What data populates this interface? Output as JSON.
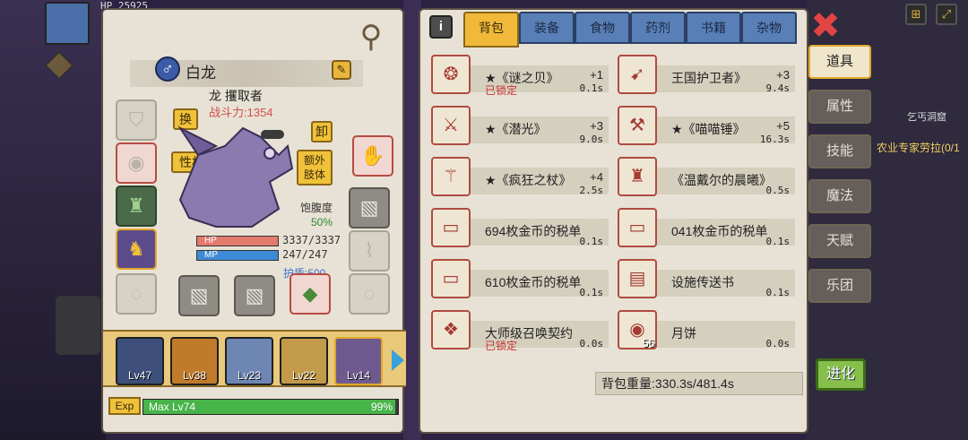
{
  "hud": {
    "hp_text": "HP 25925"
  },
  "character": {
    "gender_symbol": "♂",
    "name": "白龙",
    "race_title": "龙 攫取者",
    "power": "战斗力:1354",
    "swap_button": "换",
    "trait_button": "性格",
    "unequip_button": "卸",
    "extra_limb_button": "额外\n肢体",
    "satiety_label": "饱腹度",
    "satiety_value": "50%",
    "hp_label": "HP",
    "hp_value": "3337/3337",
    "mp_label": "MP",
    "mp_value": "247/247",
    "shield": "护盾:500"
  },
  "party": [
    {
      "level": "Lv47",
      "color": "#3d4f7a"
    },
    {
      "level": "Lv38",
      "color": "#c07a2a"
    },
    {
      "level": "Lv23",
      "color": "#6d86b4"
    },
    {
      "level": "Lv22",
      "color": "#c29a4a"
    },
    {
      "level": "Lv14",
      "color": "#6e5a8e",
      "selected": true
    }
  ],
  "exp": {
    "tag": "Exp",
    "text": "Max Lv74",
    "percent_text": "99%",
    "percent": 99
  },
  "inventory": {
    "tabs": [
      "背包",
      "装备",
      "食物",
      "药剂",
      "书籍",
      "杂物"
    ],
    "active_tab": 0,
    "items": [
      {
        "name": "★《谜之贝》",
        "qty": "+1",
        "weight": "0.1s",
        "locked": "已锁定",
        "icon": "shell-icon",
        "glyph": "❂"
      },
      {
        "name": "王国护卫者》",
        "qty": "+3",
        "weight": "9.4s",
        "icon": "crossbow-icon",
        "glyph": "➹"
      },
      {
        "name": "★《潜光》",
        "qty": "+3",
        "weight": "9.0s",
        "icon": "scythe-icon",
        "glyph": "⚔"
      },
      {
        "name": "★《喵喵锤》",
        "qty": "+5",
        "weight": "16.3s",
        "icon": "hammer-icon",
        "glyph": "⚒"
      },
      {
        "name": "★《疯狂之杖》",
        "qty": "+4",
        "weight": "2.5s",
        "icon": "staff-icon",
        "glyph": "⚚"
      },
      {
        "name": "《温戴尔的晨曦》",
        "qty": "",
        "weight": "0.5s",
        "icon": "armor-icon",
        "glyph": "♜"
      },
      {
        "name": "694枚金币的税单",
        "qty": "",
        "weight": "0.1s",
        "icon": "tax-bill-icon",
        "glyph": "▭"
      },
      {
        "name": "041枚金币的税单",
        "qty": "",
        "weight": "0.1s",
        "icon": "tax-bill-icon",
        "glyph": "▭"
      },
      {
        "name": "610枚金币的税单",
        "qty": "",
        "weight": "0.1s",
        "icon": "tax-bill-icon",
        "glyph": "▭"
      },
      {
        "name": "设施传送书",
        "qty": "",
        "weight": "0.1s",
        "icon": "teleport-book-icon",
        "glyph": "▤"
      },
      {
        "name": "大师级召唤契约",
        "qty": "",
        "weight": "0.0s",
        "locked": "已锁定",
        "icon": "summon-contract-icon",
        "glyph": "❖"
      },
      {
        "name": "月饼",
        "qty": "",
        "weight": "0.0s",
        "count": "56",
        "icon": "mooncake-icon",
        "glyph": "◉"
      }
    ],
    "weight_text": "背包重量:330.3s/481.4s"
  },
  "side_menu": [
    "道具",
    "属性",
    "技能",
    "魔法",
    "天赋",
    "乐团"
  ],
  "evolve": "进化",
  "map_label": "乞丐洞窟",
  "quest_label": "农业专家劳拉(0/1"
}
